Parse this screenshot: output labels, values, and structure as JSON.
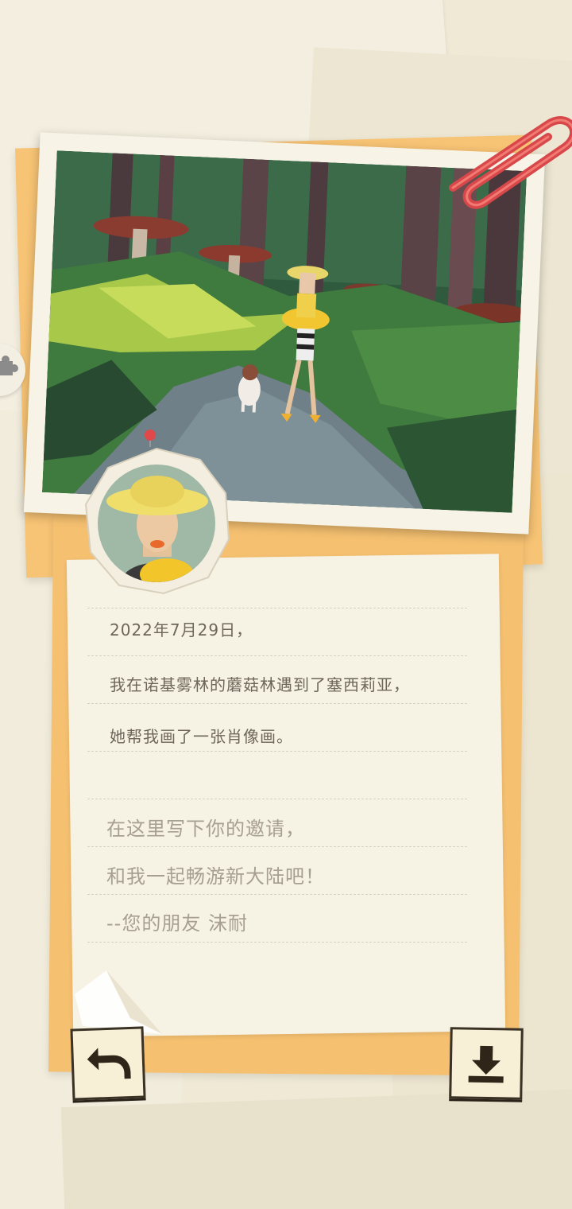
{
  "letter": {
    "date_line": "2022年7月29日，",
    "line_2": "我在诺基雾林的蘑菇林遇到了塞西莉亚，",
    "line_3": "她帮我画了一张肖像画。",
    "line_4": ""
  },
  "invitation": {
    "line_1": "在这里写下你的邀请，",
    "line_2": "和我一起畅游新大陆吧！",
    "signature": "--您的朋友  沫耐"
  },
  "colors": {
    "envelope": "#f7c374",
    "paper": "#f6f2e4",
    "paperclip": "#e0484a",
    "button_border": "#3b3226"
  },
  "icons": {
    "back": "undo-arrow-icon",
    "download": "download-icon",
    "side": "puzzle-icon"
  }
}
